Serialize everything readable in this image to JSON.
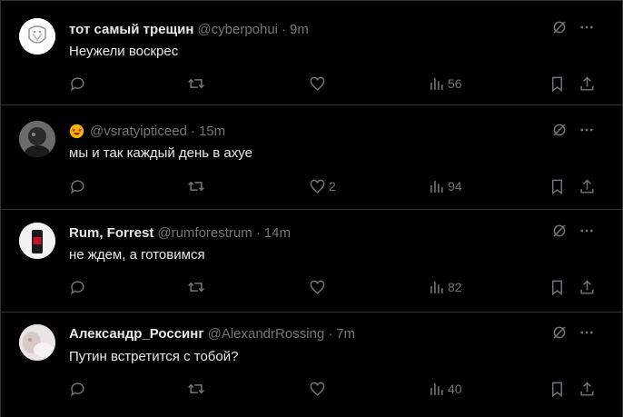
{
  "tweets": [
    {
      "name": "тот самый трещин",
      "handle": "@cyberpohui",
      "time": "9m",
      "text": "Неужели воскрес",
      "replies": "",
      "retweets": "",
      "likes": "",
      "views": "56"
    },
    {
      "name": "",
      "name_emoji": "star-struck-emoji",
      "handle": "@vsratyipticeed",
      "time": "15m",
      "text": "мы и так каждый день в ахуе",
      "replies": "",
      "retweets": "",
      "likes": "2",
      "views": "94"
    },
    {
      "name": "Rum, Forrest",
      "handle": "@rumforestrum",
      "time": "14m",
      "text": "не ждем, а готовимся",
      "replies": "",
      "retweets": "",
      "likes": "",
      "views": "82"
    },
    {
      "name": "Александр_Россинг",
      "handle": "@AlexandrRossing",
      "time": "7m",
      "text": "Путин встретится с тобой?",
      "replies": "",
      "retweets": "",
      "likes": "",
      "views": "40"
    }
  ],
  "separator": "·",
  "colors": {
    "background": "#000000",
    "text": "#e7e9ea",
    "muted": "#71767b",
    "border": "#2f3336"
  },
  "icons": [
    "reply-icon",
    "retweet-icon",
    "like-icon",
    "views-icon",
    "bookmark-icon",
    "share-icon",
    "grok-icon",
    "more-icon"
  ]
}
